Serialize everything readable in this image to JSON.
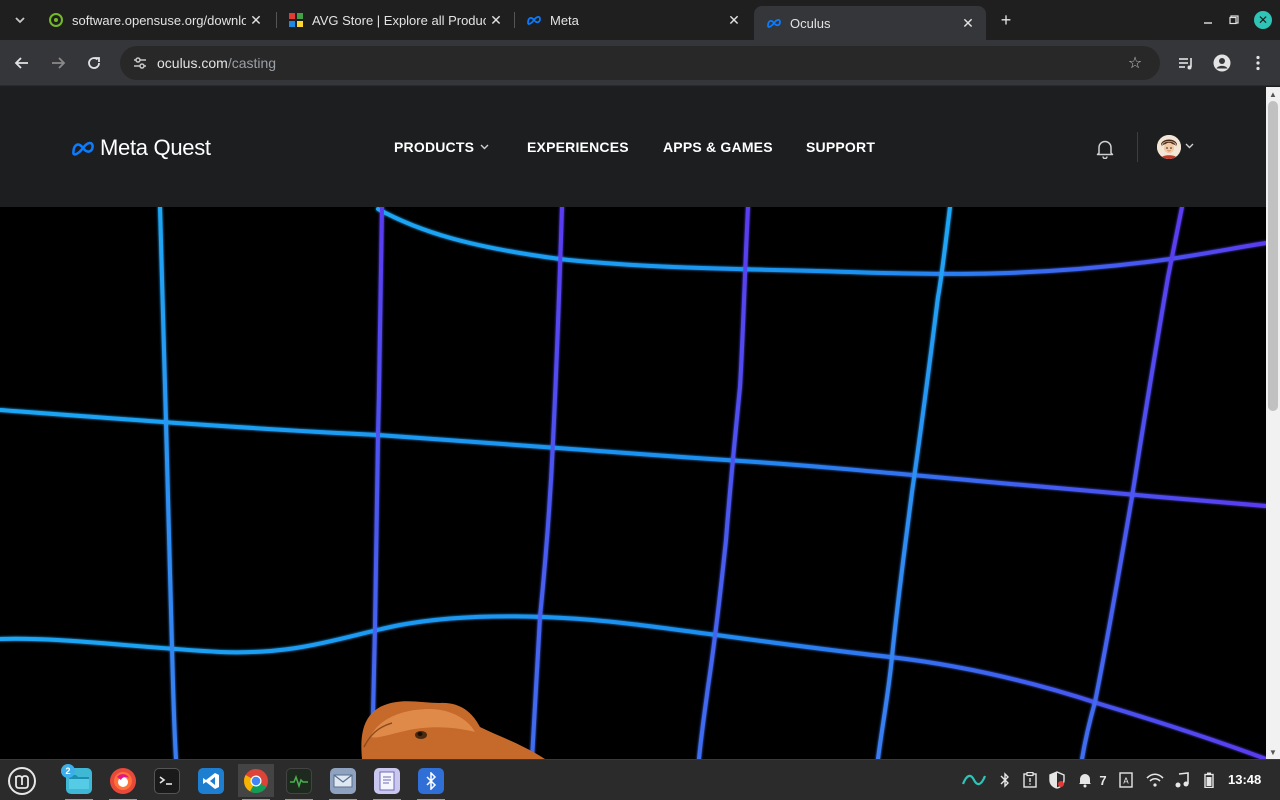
{
  "browser": {
    "tabs": [
      {
        "title": "software.opensuse.org/download"
      },
      {
        "title": "AVG Store | Explore all Products"
      },
      {
        "title": "Meta"
      },
      {
        "title": "Oculus",
        "active": true
      }
    ],
    "new_tab_label": "+",
    "url": {
      "host": "oculus.com",
      "path": "/casting"
    }
  },
  "site": {
    "logo_text": "Meta Quest",
    "nav": [
      {
        "label": "PRODUCTS",
        "has_dropdown": true
      },
      {
        "label": "EXPERIENCES"
      },
      {
        "label": "APPS & GAMES"
      },
      {
        "label": "SUPPORT"
      }
    ]
  },
  "taskbar": {
    "files_badge": "2",
    "notification_count": "7",
    "clock": "13:48"
  },
  "icons": {
    "tab_search": "chevron-down-icon",
    "back": "arrow-left-icon",
    "forward": "arrow-right-icon",
    "reload": "reload-icon",
    "site_info": "tune-icon",
    "bookmark": "star-icon",
    "media": "media-queue-icon",
    "profile": "person-icon",
    "menu": "kebab-menu-icon",
    "notifications": "bell-icon"
  },
  "colors": {
    "header_bg": "#1c1e20",
    "grid_cyan": "#1ea0f0",
    "grid_violet": "#5a3cf0",
    "meta_blue": "#0a7cff"
  }
}
